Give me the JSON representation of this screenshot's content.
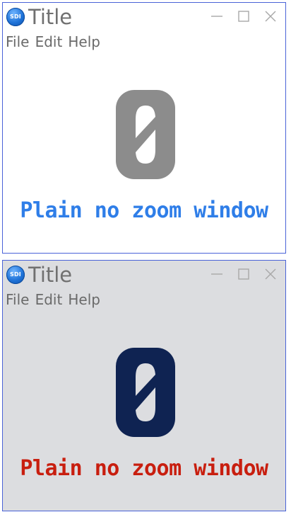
{
  "windows": [
    {
      "icon_text": "SDI",
      "title": "Title",
      "menu": [
        "File",
        "Edit",
        "Help"
      ],
      "logo_glyph": "0",
      "caption": "Plain no zoom window",
      "colors": {
        "background": "#ffffff",
        "logo": "#8c8c8c",
        "caption": "#2f7ee8"
      }
    },
    {
      "icon_text": "SDI",
      "title": "Title",
      "menu": [
        "File",
        "Edit",
        "Help"
      ],
      "logo_glyph": "0",
      "caption": "Plain no zoom window",
      "colors": {
        "background": "#dcdde0",
        "logo": "#0f2352",
        "caption": "#c81e0f"
      }
    }
  ],
  "icons": {
    "app": "sdi-app-icon",
    "minimize": "minimize-icon",
    "maximize": "maximize-icon",
    "close": "close-icon"
  }
}
